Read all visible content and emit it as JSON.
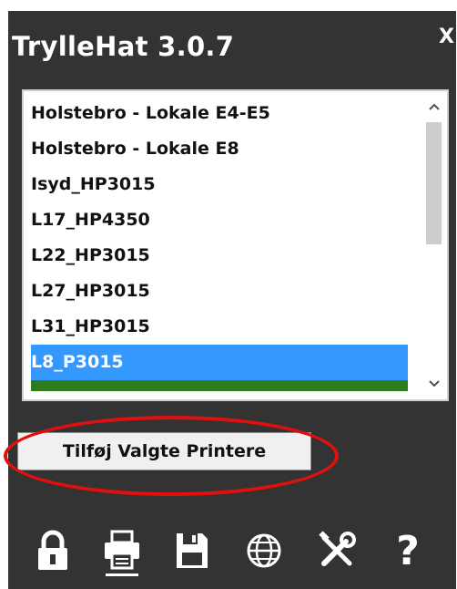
{
  "app": {
    "title": "TrylleHat 3.0.7",
    "close_label": "X"
  },
  "printer_list": {
    "items": [
      {
        "label": "Holstebro - Lokale E4-E5",
        "selected": false
      },
      {
        "label": "Holstebro - Lokale E8",
        "selected": false
      },
      {
        "label": "Isyd_HP3015",
        "selected": false
      },
      {
        "label": "L17_HP4350",
        "selected": false
      },
      {
        "label": "L22_HP3015",
        "selected": false
      },
      {
        "label": "L27_HP3015",
        "selected": false
      },
      {
        "label": "L31_HP3015",
        "selected": false
      },
      {
        "label": "L8_P3015",
        "selected": true
      }
    ],
    "scroll_up_icon": "chevron-up-icon",
    "scroll_down_icon": "chevron-down-icon"
  },
  "actions": {
    "add_selected_printers_label": "Tilføj Valgte Printere"
  },
  "toolbar": {
    "icons": [
      "lock-icon",
      "printer-icon",
      "save-icon",
      "globe-icon",
      "tools-icon",
      "help-icon"
    ],
    "help_glyph": "?",
    "active_icon": "printer-icon"
  },
  "colors": {
    "panel_bg": "#333333",
    "selection": "#3399ff",
    "annotation_ellipse": "#e01010"
  }
}
